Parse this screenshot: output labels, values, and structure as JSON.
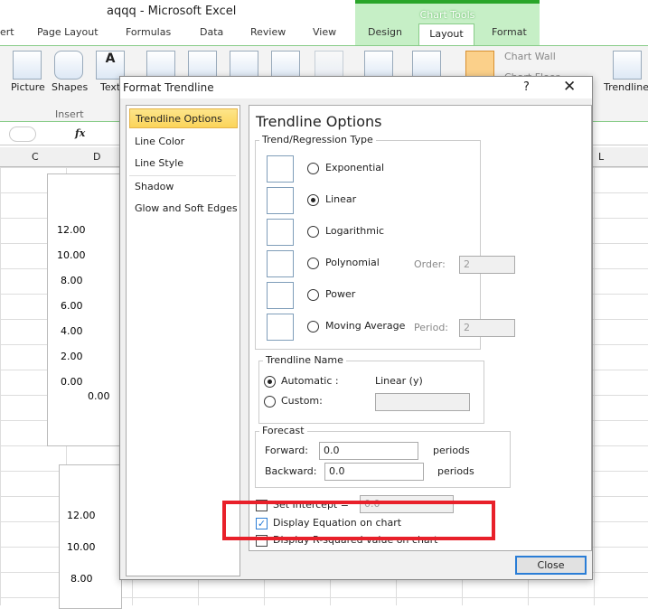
{
  "window": {
    "title": "aqqq  -  Microsoft Excel"
  },
  "ribbon": {
    "tabs": [
      "ert",
      "Page Layout",
      "Formulas",
      "Data",
      "Review",
      "View"
    ],
    "chart_tools_label": "Chart Tools",
    "chart_tabs": [
      "Design",
      "Layout",
      "Format"
    ],
    "active_tab": "Layout",
    "insert_group": {
      "label": "Insert",
      "buttons": [
        "Picture",
        "Shapes",
        "Text Box"
      ]
    },
    "chart_wall": "Chart Wall",
    "chart_floor": "Chart Floor",
    "trendline": "Trendline"
  },
  "formula_bar": {
    "fx": "fx"
  },
  "columns": [
    "C",
    "D",
    "L"
  ],
  "sheet_chart": {
    "y_ticks": [
      "12.00",
      "10.00",
      "8.00",
      "6.00",
      "4.00",
      "2.00",
      "0.00"
    ],
    "x_tick": "0.00"
  },
  "sheet_chart2": {
    "y_ticks": [
      "12.00",
      "10.00",
      "8.00"
    ]
  },
  "dialog": {
    "title": "Format Trendline",
    "help": "?",
    "nav": [
      "Trendline Options",
      "Line Color",
      "Line Style",
      "Shadow",
      "Glow and Soft Edges"
    ],
    "heading": "Trendline Options",
    "type_group": "Trend/Regression Type",
    "types": [
      "Exponential",
      "Linear",
      "Logarithmic",
      "Polynomial",
      "Power",
      "Moving Average"
    ],
    "selected_type": "Linear",
    "order_label": "Order:",
    "order_value": "2",
    "period_label": "Period:",
    "period_value": "2",
    "name_group": "Trendline Name",
    "automatic_label": "Automatic :",
    "automatic_value": "Linear (y)",
    "custom_label": "Custom:",
    "custom_value": "",
    "name_selected": "Automatic",
    "forecast_group": "Forecast",
    "forward_label": "Forward:",
    "forward_value": "0.0",
    "forward_unit": "periods",
    "backward_label": "Backward:",
    "backward_value": "0.0",
    "backward_unit": "periods",
    "set_intercept_label": "Set Intercept =",
    "set_intercept_value": "0.0",
    "set_intercept_checked": false,
    "display_equation_label": "Display Equation on chart",
    "display_equation_checked": true,
    "display_r2_label": "Display R-squared value on chart",
    "display_r2_checked": false,
    "close": "Close"
  },
  "colors": {
    "highlight": "#e8202a",
    "chart_tools": "#2aa52a",
    "accent": "#2a7dd6"
  }
}
